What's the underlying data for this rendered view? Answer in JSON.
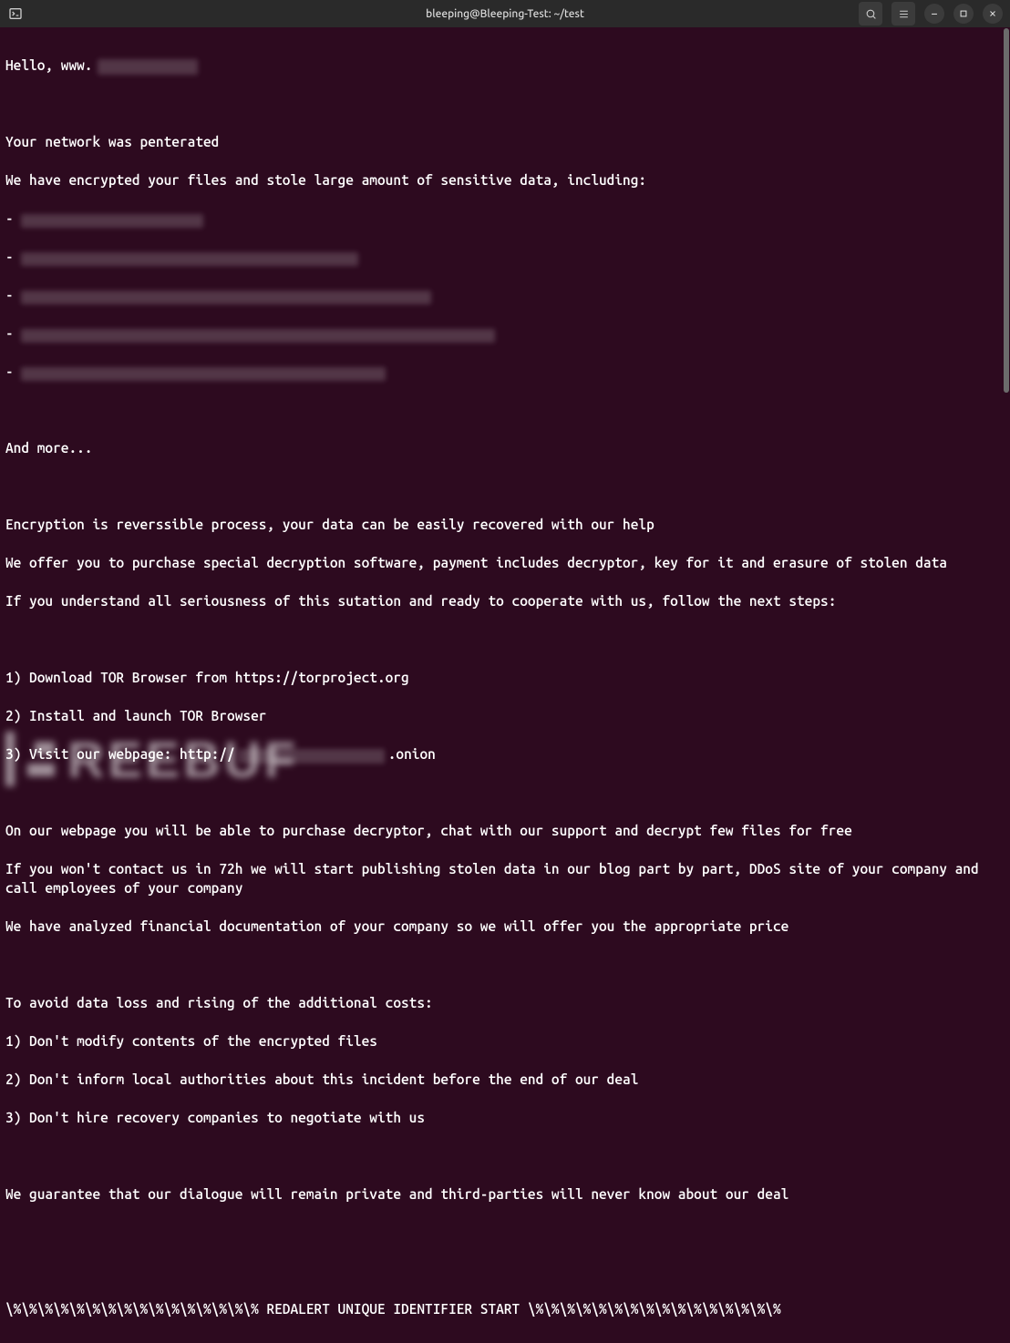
{
  "titlebar": {
    "title": "bleeping@Bleeping-Test: ~/test"
  },
  "terminal": {
    "greeting_prefix": "Hello, www.",
    "l_penetrated": "Your network was penterated",
    "l_encrypted": "We have encrypted your files and stole large amount of sensitive data, including:",
    "l_andmore": "And more...",
    "l_reverse": "Encryption is reverssible process, your data can be easily recovered with our help",
    "l_offer": "We offer you to purchase special decryption software, payment includes decryptor, key for it and erasure of stolen data",
    "l_understand": "If you understand all seriousness of this sutation and ready to cooperate with us, follow the next steps:",
    "l_step1": "1) Download TOR Browser from https://torproject.org",
    "l_step2": "2) Install and launch TOR Browser",
    "l_step3_prefix": "3) Visit our webpage: http://",
    "l_step3_suffix": ".onion",
    "l_webpage": "On our webpage you will be able to purchase decryptor, chat with our support and decrypt few files for free",
    "l_72h": "If you won't contact us in 72h we will start publishing stolen data in our blog part by part, DDoS site of your company and call employees of your company",
    "l_analyzed": "We have analyzed financial documentation of your company so we will offer you the appropriate price",
    "l_avoid": "To avoid data loss and rising of the additional costs:",
    "l_dont1": "1) Don't modify contents of the encrypted files",
    "l_dont2": "2) Don't inform local authorities about this incident before the end of our deal",
    "l_dont3": "3) Don't hire recovery companies to negotiate with us",
    "l_guarantee": "We guarantee that our dialogue will remain private and third-parties will never know about our deal",
    "l_redalert": "\\%\\%\\%\\%\\%\\%\\%\\%\\%\\%\\%\\%\\%\\%\\%\\% REDALERT UNIQUE IDENTIFIER START \\%\\%\\%\\%\\%\\%\\%\\%\\%\\%\\%\\%\\%\\%\\%\\%"
  },
  "watermark": {
    "text": "REEBUF"
  }
}
